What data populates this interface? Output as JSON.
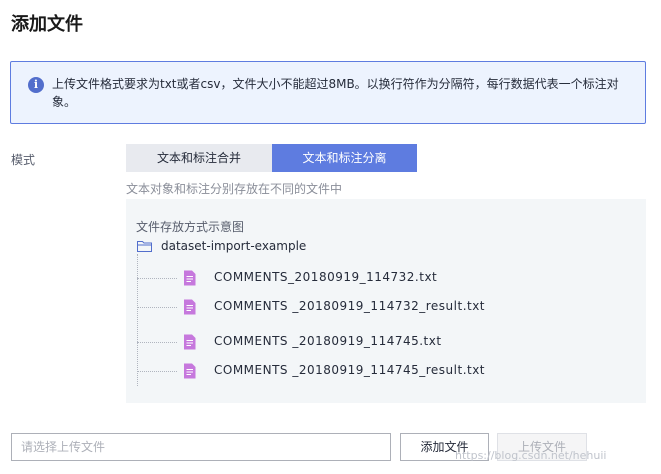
{
  "dialog": {
    "title": "添加文件",
    "close_glyph": "︶"
  },
  "info": {
    "icon": "info-icon",
    "icon_glyph": "i",
    "text": "上传文件格式要求为txt或者csv，文件大小不能超过8MB。以换行符作为分隔符，每行数据代表一个标注对象。"
  },
  "mode": {
    "label": "模式",
    "options": [
      {
        "label": "文本和标注合并",
        "selected": false
      },
      {
        "label": "文本和标注分离",
        "selected": true
      }
    ],
    "description": "文本对象和标注分别存放在不同的文件中"
  },
  "example": {
    "title": "文件存放方式示意图",
    "folder": "dataset-import-example",
    "files": [
      "COMMENTS_20180919_114732.txt",
      "COMMENTS _20180919_114732_result.txt",
      "COMMENTS _20180919_114745.txt",
      "COMMENTS _20180919_114745_result.txt"
    ]
  },
  "upload": {
    "placeholder": "请选择上传文件",
    "add_label": "添加文件",
    "upload_label": "上传文件"
  },
  "watermark": "https://blog.csdn.net/hehuii",
  "colors": {
    "accent": "#5e7ce0",
    "banner_bg": "#edf3fe",
    "file_icon": "#c678dd",
    "folder_icon": "#526ecc"
  }
}
